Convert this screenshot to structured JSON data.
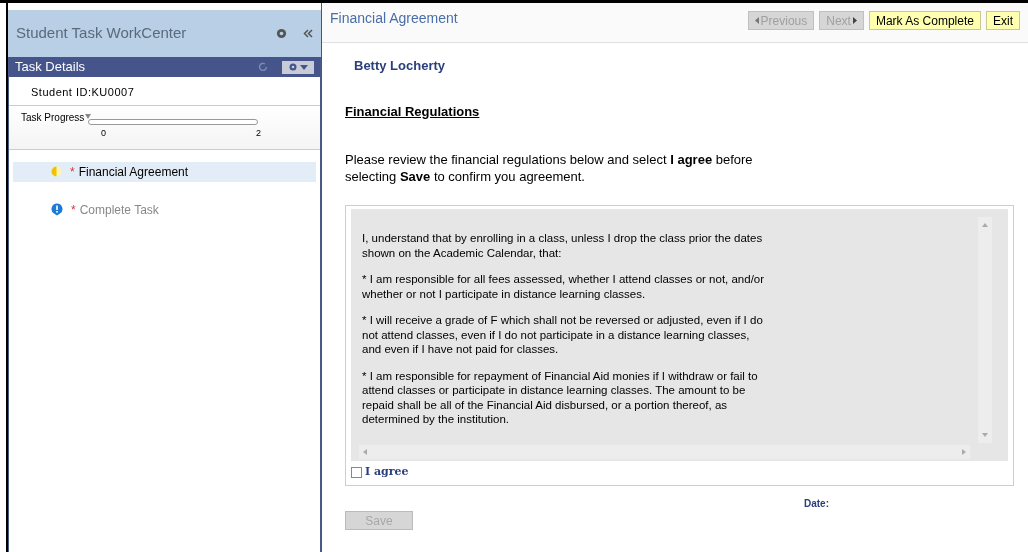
{
  "sidebar": {
    "title": "Student Task WorkCenter",
    "section_title": "Task Details",
    "student_id": "Student ID:KU0007",
    "progress": {
      "label": "Task Progress",
      "level": 0,
      "min": "0",
      "max": "2"
    },
    "tasks": [
      {
        "label": "Financial Agreement",
        "required": "*",
        "kind": "in-progress",
        "selected": true
      },
      {
        "label": "Complete Task",
        "required": "*",
        "kind": "info",
        "selected": false
      }
    ]
  },
  "header": {
    "title": "Financial Agreement",
    "buttons": [
      {
        "label": "Previous",
        "kind": "prev",
        "disabled": true
      },
      {
        "label": "Next",
        "kind": "next",
        "disabled": true
      },
      {
        "label": "Mark As Complete",
        "kind": "plain",
        "disabled": false
      },
      {
        "label": "Exit",
        "kind": "plain",
        "disabled": false
      }
    ]
  },
  "student_name": "Betty Locherty",
  "section_heading": "Financial Regulations",
  "instructions": "Please review the financial regulations below and select **I agree** before selecting **Save** to confirm you agreement.",
  "agreement_paragraphs": [
    "I, understand that by enrolling in a class, unless I drop the class prior the dates shown on the Academic Calendar, that:",
    "* I am responsible for all fees assessed, whether I attend classes or not, and/or whether or not I participate in distance learning classes.",
    "* I will receive a grade of F which shall not be reversed or adjusted, even if I do not attend classes, even if I do not participate in a distance learning classes, and even if I have not paid for classes.",
    "* I am responsible for repayment of Financial Aid monies if I withdraw or fail to attend classes or participate in distance learning classes. The amount to be repaid shall be all of the Financial Aid disbursed, or a portion thereof, as determined by the institution."
  ],
  "agree": {
    "label": "I agree",
    "checked": false
  },
  "date_label": "Date:",
  "save": {
    "label": "Save",
    "disabled": true
  }
}
